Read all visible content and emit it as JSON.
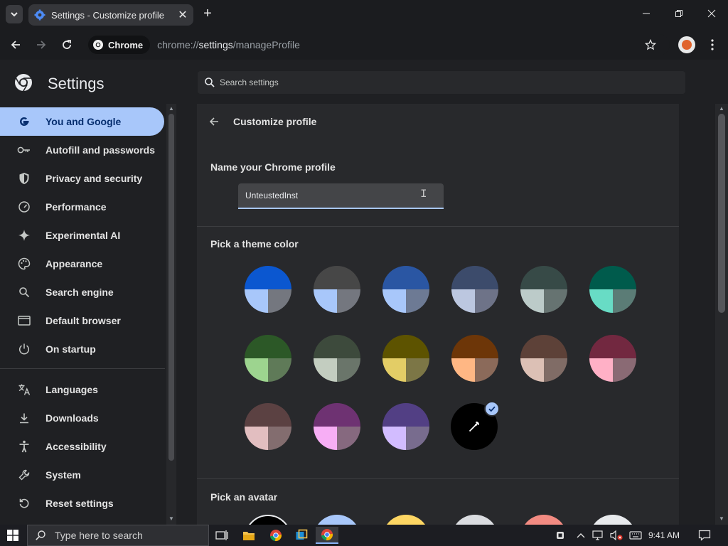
{
  "window": {
    "tab_title": "Settings - Customize profile",
    "close_tab_label": "✕",
    "new_tab_label": "+"
  },
  "toolbar": {
    "chip_label": "Chrome",
    "url_scheme": "chrome://",
    "url_host": "settings",
    "url_path": "/manageProfile"
  },
  "settings": {
    "title": "Settings",
    "search_placeholder": "Search settings"
  },
  "sidebar": {
    "items": [
      {
        "label": "You and Google",
        "icon": "google-g-icon",
        "active": true
      },
      {
        "label": "Autofill and passwords",
        "icon": "key-icon"
      },
      {
        "label": "Privacy and security",
        "icon": "shield-icon"
      },
      {
        "label": "Performance",
        "icon": "speedometer-icon"
      },
      {
        "label": "Experimental AI",
        "icon": "sparkle-icon"
      },
      {
        "label": "Appearance",
        "icon": "palette-icon"
      },
      {
        "label": "Search engine",
        "icon": "search-icon"
      },
      {
        "label": "Default browser",
        "icon": "browser-window-icon"
      },
      {
        "label": "On startup",
        "icon": "power-icon"
      },
      {
        "label": "Languages",
        "icon": "translate-icon"
      },
      {
        "label": "Downloads",
        "icon": "download-icon"
      },
      {
        "label": "Accessibility",
        "icon": "accessibility-icon"
      },
      {
        "label": "System",
        "icon": "wrench-icon"
      },
      {
        "label": "Reset settings",
        "icon": "reset-icon"
      }
    ]
  },
  "main": {
    "page_title": "Customize profile",
    "name_section_label": "Name your Chrome profile",
    "profile_name_value": "UnteustedInst",
    "theme_section_label": "Pick a theme color",
    "avatar_section_label": "Pick an avatar",
    "selected_theme": "custom-color-picker",
    "theme_colors": [
      {
        "top": "#0b57d0",
        "bl": "#a8c7fa",
        "br": "#74777f"
      },
      {
        "top": "#474747",
        "bl": "#a8c7fa",
        "br": "#74777f"
      },
      {
        "top": "#2a56a3",
        "bl": "#a8c7fa",
        "br": "#6d7a94"
      },
      {
        "top": "#3c4b6b",
        "bl": "#bcc7e0",
        "br": "#6e7388"
      },
      {
        "top": "#374a47",
        "bl": "#bccbc9",
        "br": "#667371"
      },
      {
        "top": "#005b4c",
        "bl": "#68dcc5",
        "br": "#5b7c76"
      },
      {
        "top": "#2c5827",
        "bl": "#9dd48f",
        "br": "#5f7a58"
      },
      {
        "top": "#3d4a3c",
        "bl": "#c3cdc0",
        "br": "#6a756a"
      },
      {
        "top": "#5d5300",
        "bl": "#e3cd66",
        "br": "#7c7646"
      },
      {
        "top": "#6d3608",
        "bl": "#ffb784",
        "br": "#8b6a5a"
      },
      {
        "top": "#5d4138",
        "bl": "#dcc0b5",
        "br": "#806c66"
      },
      {
        "top": "#722840",
        "bl": "#ffb0c6",
        "br": "#8a6a74"
      },
      {
        "top": "#5b4142",
        "bl": "#e2bec0",
        "br": "#836d6f"
      },
      {
        "top": "#6e3272",
        "bl": "#f7aef5",
        "br": "#86697f"
      },
      {
        "top": "#523f84",
        "bl": "#d2bcff",
        "br": "#786c8e"
      }
    ],
    "avatar_colors": [
      "#000000",
      "#a8c7fa",
      "#fdd663",
      "#dadce0",
      "#f28b82",
      "#e8eaed"
    ]
  },
  "taskbar": {
    "search_placeholder": "Type here to search",
    "clock": "9:41 AM"
  }
}
